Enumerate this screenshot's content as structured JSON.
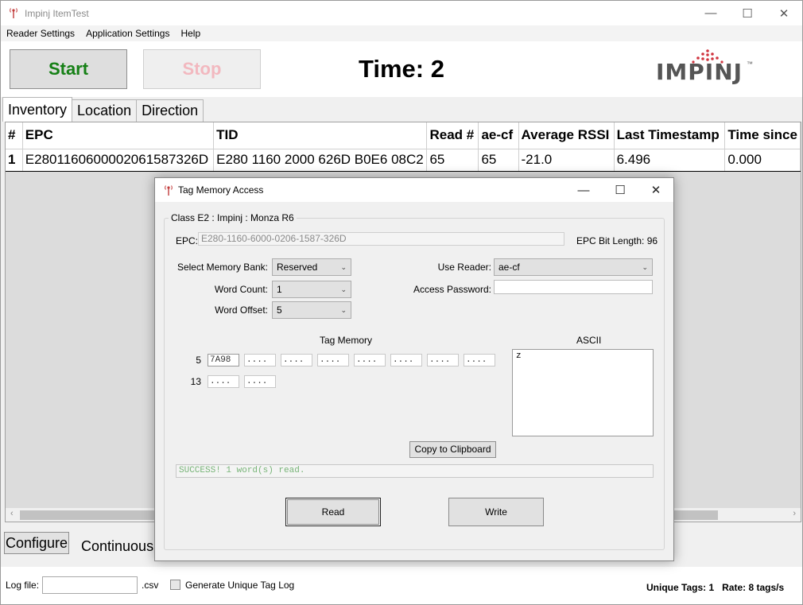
{
  "window": {
    "title": "Impinj ItemTest",
    "minimize_icon": "—",
    "maximize_icon": "☐",
    "close_icon": "✕"
  },
  "menu": [
    "Reader Settings",
    "Application Settings",
    "Help"
  ],
  "toolbar": {
    "start_label": "Start",
    "stop_label": "Stop",
    "time_label": "Time: 2",
    "logo_text": "IMPINJ",
    "logo_tm": "™",
    "start_color": "#168016",
    "stop_color": "#f2b8bf"
  },
  "tabs": [
    "Inventory",
    "Location",
    "Direction"
  ],
  "grid": {
    "columns": [
      "#",
      "EPC",
      "TID",
      "Read #",
      "ae-cf",
      "Average RSSI",
      "Last Timestamp",
      "Time since"
    ],
    "rows": [
      [
        "1",
        "E2801160600002061587326D",
        "E280 1160 2000 626D B0E6 08C2",
        "65",
        "65",
        "-21.0",
        "6.496",
        "0.000"
      ]
    ],
    "scroll_left": "‹",
    "scroll_right": "›"
  },
  "bottom": {
    "configure_label": "Configure",
    "mode_label": "Continuous"
  },
  "status": {
    "logfile_label": "Log file:",
    "logfile_value": "",
    "csv_label": ".csv",
    "unique_log_label": "Generate Unique Tag Log",
    "stats": "Unique Tags: 1   Rate: 8 tags/s"
  },
  "dialog": {
    "title": "Tag Memory Access",
    "group_label": "Class E2 : Impinj : Monza R6",
    "epc_label": "EPC:",
    "epc_value": "E280-1160-6000-0206-1587-326D",
    "epc_bit_length": "EPC Bit Length: 96",
    "memory_bank_label": "Select Memory Bank:",
    "memory_bank_value": "Reserved",
    "word_count_label": "Word Count:",
    "word_count_value": "1",
    "word_offset_label": "Word Offset:",
    "word_offset_value": "5",
    "use_reader_label": "Use Reader:",
    "use_reader_value": "ae-cf",
    "access_password_label": "Access Password:",
    "access_password_value": "",
    "tag_memory_label": "Tag Memory",
    "ascii_label": "ASCII",
    "memory_rows": [
      {
        "offset": "5",
        "words": [
          "7A98",
          "....",
          "....",
          "....",
          "....",
          "....",
          "....",
          "...."
        ]
      },
      {
        "offset": "13",
        "words": [
          "....",
          "...."
        ]
      }
    ],
    "ascii_value": "z",
    "copy_label": "Copy to Clipboard",
    "status_message": "SUCCESS! 1 word(s) read.",
    "read_label": "Read",
    "write_label": "Write",
    "dropdown_icon": "⌄"
  }
}
